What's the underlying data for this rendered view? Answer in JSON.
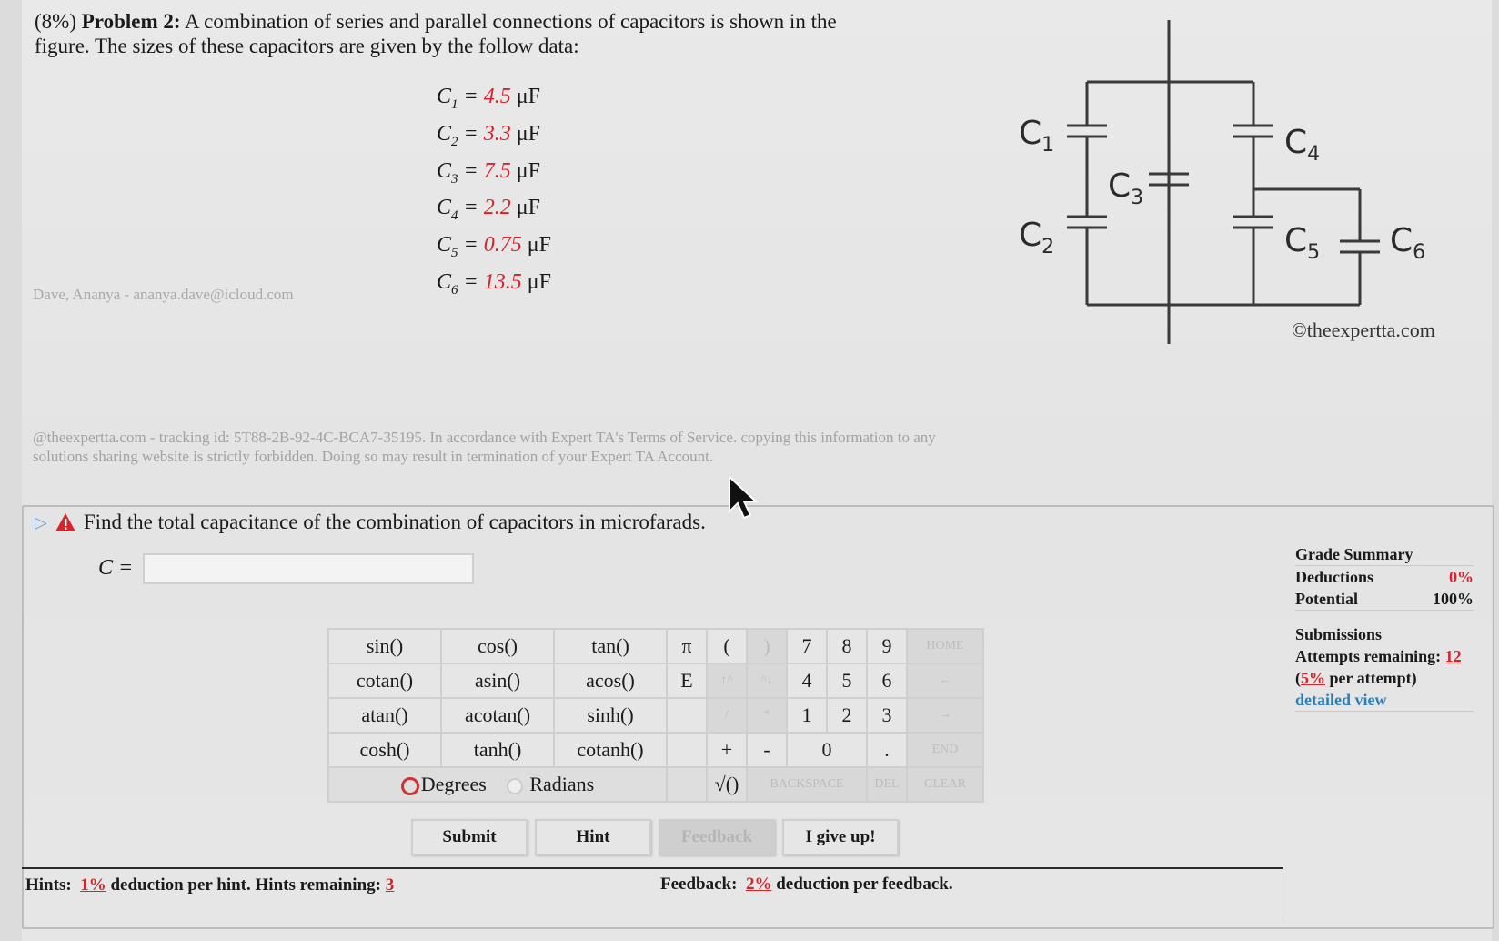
{
  "problem": {
    "weight": "(8%)",
    "label": "Problem 2:",
    "line1": "A combination of series and parallel connections of capacitors is shown in the",
    "line2": "figure. The sizes of these capacitors are given by the follow data:"
  },
  "capacitors": [
    {
      "name": "C",
      "sub": "1",
      "value": "4.5",
      "unit": "μF"
    },
    {
      "name": "C",
      "sub": "2",
      "value": "3.3",
      "unit": "μF"
    },
    {
      "name": "C",
      "sub": "3",
      "value": "7.5",
      "unit": "μF"
    },
    {
      "name": "C",
      "sub": "4",
      "value": "2.2",
      "unit": "μF"
    },
    {
      "name": "C",
      "sub": "5",
      "value": "0.75",
      "unit": "μF"
    },
    {
      "name": "C",
      "sub": "6",
      "value": "13.5",
      "unit": "μF"
    }
  ],
  "user_watermark": "Dave, Ananya - ananya.dave@icloud.com",
  "tracking_text": "@theexpertta.com - tracking id: 5T88-2B-92-4C-BCA7-35195. In accordance with Expert TA's Terms of Service. copying this information to any solutions sharing website is strictly forbidden. Doing so may result in termination of your Expert TA Account.",
  "diagram": {
    "labels": {
      "c1": "C",
      "c1s": "1",
      "c2": "C",
      "c2s": "2",
      "c3": "C",
      "c3s": "3",
      "c4": "C",
      "c4s": "4",
      "c5": "C",
      "c5s": "5",
      "c6": "C",
      "c6s": "6"
    },
    "copyright": "©theexpertta.com"
  },
  "question": {
    "text": "Find the total capacitance of the combination of capacitors in microfarads.",
    "var_label": "C =",
    "input_value": "",
    "icons": {
      "expand": "play-triangle-icon",
      "warning": "warning-icon"
    }
  },
  "keypad": {
    "functions": [
      [
        "sin()",
        "cos()",
        "tan()"
      ],
      [
        "cotan()",
        "asin()",
        "acos()"
      ],
      [
        "atan()",
        "acotan()",
        "sinh()"
      ],
      [
        "cosh()",
        "tanh()",
        "cotanh()"
      ]
    ],
    "keys": [
      [
        "π",
        "(",
        ")",
        "7",
        "8",
        "9",
        "HOME"
      ],
      [
        "E",
        "↑^",
        "^↓",
        "4",
        "5",
        "6",
        "←"
      ],
      [
        "",
        "/",
        "*",
        "1",
        "2",
        "3",
        "→"
      ],
      [
        "",
        "+",
        "-",
        "0",
        ".",
        "END"
      ]
    ],
    "degrees_label": "Degrees",
    "radians_label": "Radians",
    "sqrt_label": "√()",
    "backspace_label": "BACKSPACE",
    "del_label": "DEL",
    "clear_label": "CLEAR"
  },
  "buttons": {
    "submit": "Submit",
    "hint": "Hint",
    "feedback": "Feedback",
    "give_up": "I give up!"
  },
  "hints": {
    "label": "Hints:",
    "percent": "1%",
    "text": "deduction per hint. Hints remaining:",
    "remaining": "3"
  },
  "feedback": {
    "label": "Feedback:",
    "percent": "2%",
    "text": "deduction per feedback."
  },
  "grade_summary": {
    "title": "Grade Summary",
    "deductions_label": "Deductions",
    "deductions_value": "0%",
    "potential_label": "Potential",
    "potential_value": "100%",
    "submissions_title": "Submissions",
    "attempts_label": "Attempts remaining:",
    "attempts_value": "12",
    "per_attempt_pct": "5%",
    "per_attempt_text": "per attempt)",
    "detailed_view": "detailed view"
  }
}
